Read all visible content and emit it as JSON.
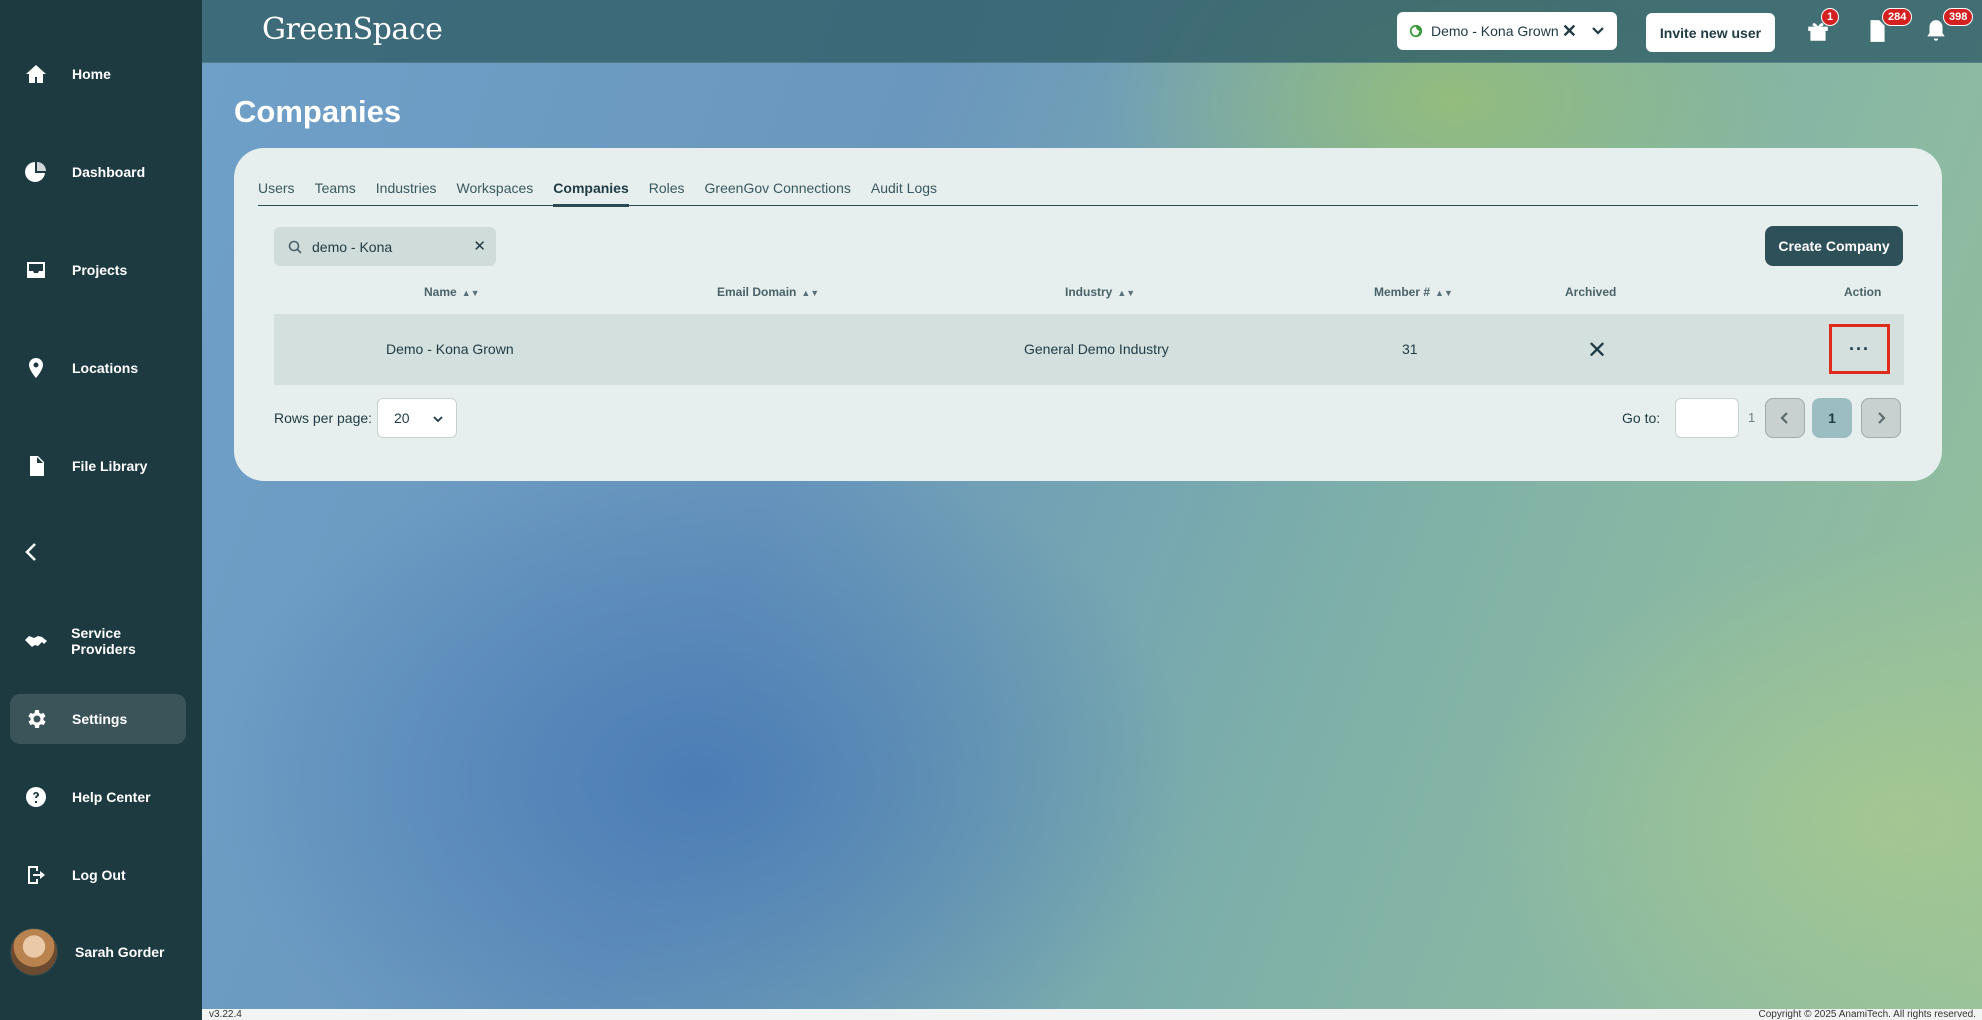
{
  "app": {
    "logo_text": "GreenSpace"
  },
  "sidebar": {
    "items": [
      {
        "label": "Home",
        "icon": "home-icon"
      },
      {
        "label": "Dashboard",
        "icon": "pie-chart-icon"
      },
      {
        "label": "Projects",
        "icon": "inbox-icon"
      },
      {
        "label": "Locations",
        "icon": "map-pin-icon"
      },
      {
        "label": "File Library",
        "icon": "file-icon"
      },
      {
        "label": "Service Providers",
        "icon": "handshake-icon"
      },
      {
        "label": "Settings",
        "icon": "gear-icon",
        "active": true
      },
      {
        "label": "Help Center",
        "icon": "help-icon"
      },
      {
        "label": "Log Out",
        "icon": "logout-icon"
      }
    ],
    "user_name": "Sarah Gorder"
  },
  "topbar": {
    "workspace": "Demo - Kona Grown",
    "invite_label": "Invite new user",
    "badges": {
      "gift": "1",
      "docs": "284",
      "notifications": "398"
    }
  },
  "page": {
    "title": "Companies",
    "tabs": [
      "Users",
      "Teams",
      "Industries",
      "Workspaces",
      "Companies",
      "Roles",
      "GreenGov Connections",
      "Audit Logs"
    ],
    "active_tab": "Companies",
    "search_value": "demo - Kona",
    "create_label": "Create Company",
    "columns": {
      "name": "Name",
      "email_domain": "Email Domain",
      "industry": "Industry",
      "member": "Member #",
      "archived": "Archived",
      "action": "Action"
    },
    "rows": [
      {
        "name": "Demo - Kona Grown",
        "email_domain": "",
        "industry": "General Demo Industry",
        "member": "31",
        "archived": "✕",
        "action": "···"
      }
    ],
    "pagination": {
      "rows_per_page_label": "Rows per page:",
      "rows_per_page": "20",
      "goto_label": "Go to:",
      "total_pages": "1",
      "current_page": "1"
    }
  },
  "footer": {
    "version": "v3.22.4",
    "copyright": "Copyright © 2025 AnamiTech. All rights reserved."
  },
  "colors": {
    "sidebar": "#1d3a41",
    "accent": "#2e5159",
    "badge": "#d32121",
    "highlight": "#e02a1a"
  }
}
